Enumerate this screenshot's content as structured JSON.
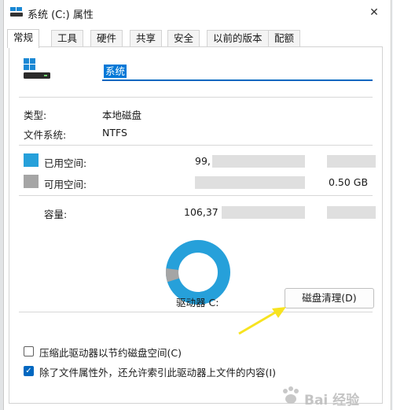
{
  "window": {
    "title": "系统 (C:) 属性",
    "close_glyph": "✕"
  },
  "tabs": [
    {
      "label": "常规",
      "active": true
    },
    {
      "label": "工具"
    },
    {
      "label": "硬件"
    },
    {
      "label": "共享"
    },
    {
      "label": "安全"
    },
    {
      "label": "以前的版本"
    },
    {
      "label": "配额"
    }
  ],
  "general": {
    "drive_name": "系统",
    "type_label": "类型:",
    "type_value": "本地磁盘",
    "fs_label": "文件系统:",
    "fs_value": "NTFS",
    "used_label": "已用空间:",
    "used_value_visible": "99,",
    "free_label": "可用空间:",
    "free_value_visible": "0.50 GB",
    "capacity_label": "容量:",
    "capacity_value_visible": "106,37",
    "drive_label": "驱动器 C:",
    "cleanup_button": "磁盘清理(D)",
    "compress_label": "压缩此驱动器以节约磁盘空间(C)",
    "compress_checked": false,
    "index_label": "除了文件属性外，还允许索引此驱动器上文件的内容(I)",
    "index_checked": true
  },
  "colors": {
    "used": "#26a0da",
    "free": "#a5a5a5",
    "accent": "#0067c0",
    "arrow": "#f7e320"
  },
  "watermark": {
    "text": "Bai 经验"
  },
  "icons": {
    "app": "drive-icon",
    "drive": "drive-icon",
    "close": "close-icon",
    "checkmark": "checkmark-icon"
  }
}
